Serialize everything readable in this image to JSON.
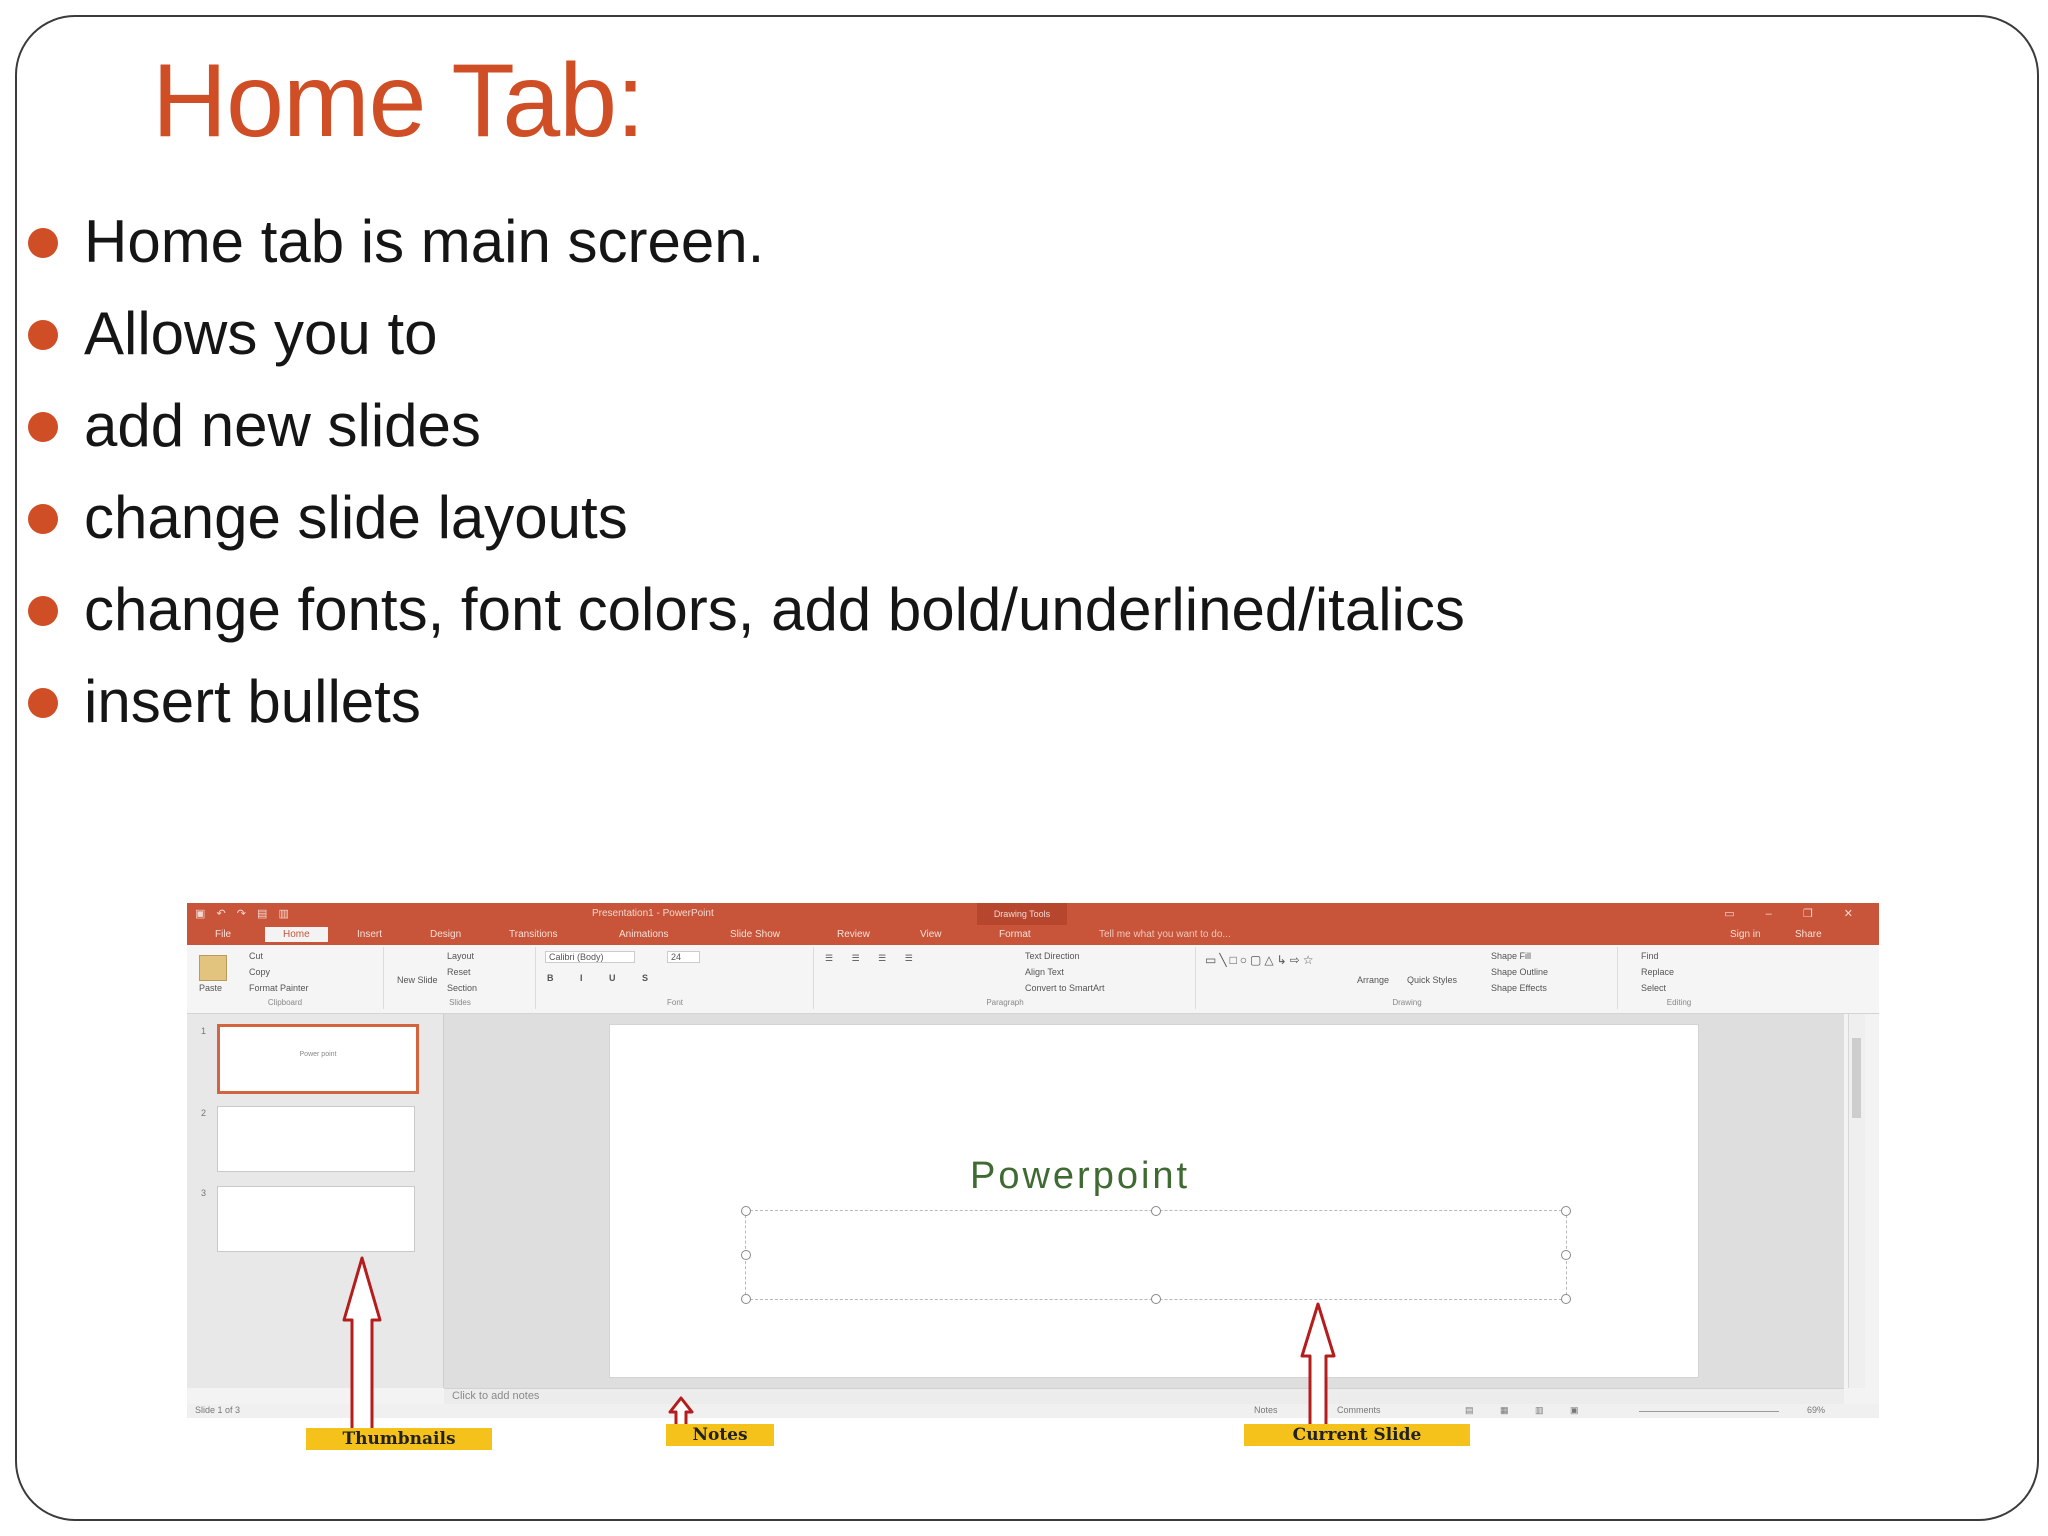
{
  "slide": {
    "title": "Home Tab:",
    "bullets": [
      "Home tab is main screen.",
      "Allows you to",
      "add new slides",
      "change slide layouts",
      "change fonts, font colors, add bold/underlined/italics",
      "insert bullets"
    ],
    "colors": {
      "accent": "#d04e26",
      "text": "#151515"
    }
  },
  "screenshot": {
    "window_title": "Presentation1 - PowerPoint",
    "contextual_tab": "Drawing Tools",
    "tabs": [
      "File",
      "Home",
      "Insert",
      "Design",
      "Transitions",
      "Animations",
      "Slide Show",
      "Review",
      "View",
      "Format"
    ],
    "tell_me": "Tell me what you want to do...",
    "sign_in": "Sign in",
    "share": "Share",
    "ribbon": {
      "clipboard": {
        "paste": "Paste",
        "cut": "Cut",
        "copy": "Copy",
        "format_painter": "Format Painter",
        "label": "Clipboard"
      },
      "slides": {
        "new_slide": "New Slide",
        "layout": "Layout",
        "reset": "Reset",
        "section": "Section",
        "label": "Slides"
      },
      "font": {
        "name": "Calibri (Body)",
        "size": "24",
        "label": "Font"
      },
      "paragraph": {
        "text_direction": "Text Direction",
        "align_text": "Align Text",
        "convert_smartart": "Convert to SmartArt",
        "label": "Paragraph"
      },
      "drawing": {
        "arrange": "Arrange",
        "quick_styles": "Quick Styles",
        "shape_fill": "Shape Fill",
        "shape_outline": "Shape Outline",
        "shape_effects": "Shape Effects",
        "label": "Drawing"
      },
      "editing": {
        "find": "Find",
        "replace": "Replace",
        "select": "Select",
        "label": "Editing"
      }
    },
    "thumbnails": [
      {
        "num": "1",
        "text": "Power point"
      },
      {
        "num": "2",
        "text": ""
      },
      {
        "num": "3",
        "text": ""
      }
    ],
    "current_slide_title": "Powerpoint",
    "notes_placeholder": "Click to add notes",
    "status": {
      "slide_of": "Slide 1 of 3",
      "notes": "Notes",
      "comments": "Comments",
      "zoom": "69%"
    }
  },
  "callouts": {
    "thumbnails": "Thumbnails",
    "notes": "Notes",
    "current_slide": "Current Slide"
  }
}
